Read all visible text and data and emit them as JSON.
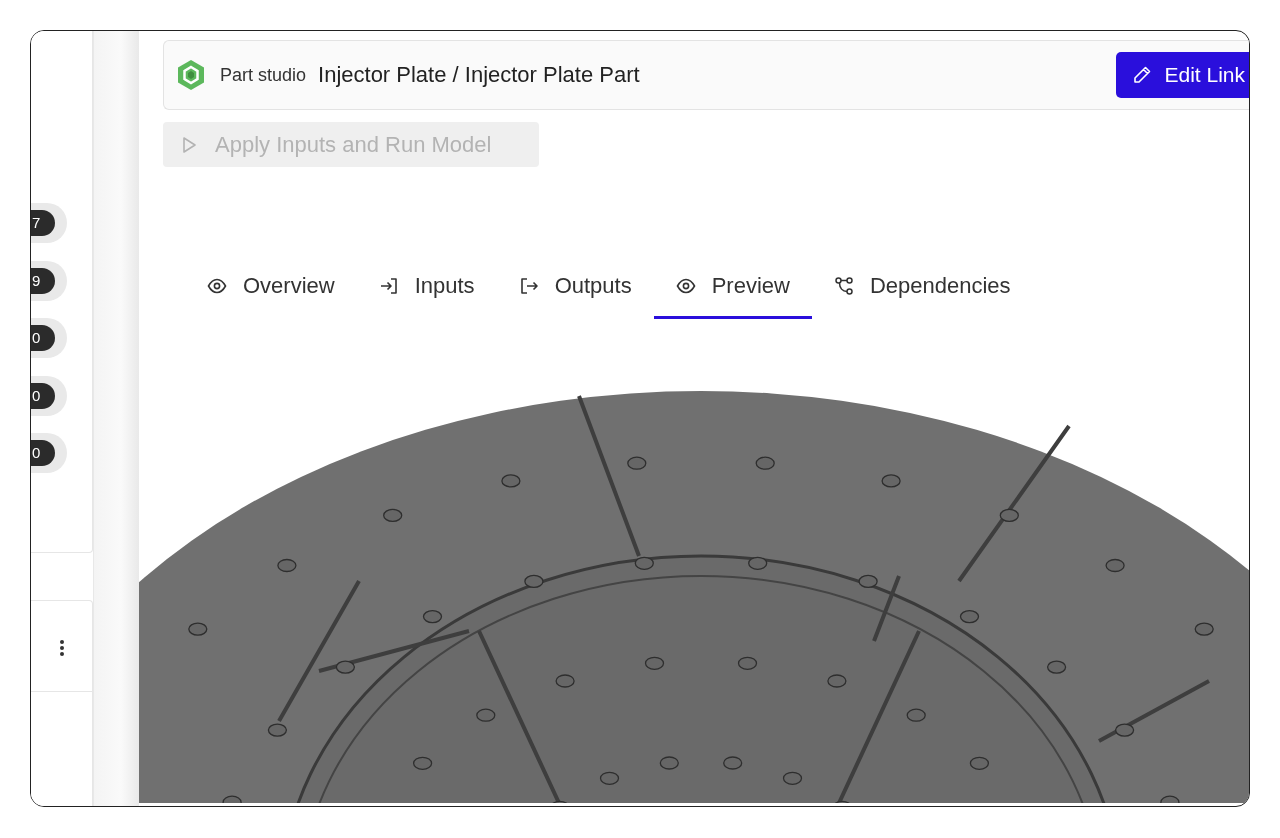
{
  "sidebar": {
    "badges": [
      {
        "count": "7"
      },
      {
        "count": "9"
      },
      {
        "count": "0"
      },
      {
        "count": "0"
      },
      {
        "count": "0"
      }
    ]
  },
  "header": {
    "type_label": "Part studio",
    "title": "Injector Plate / Injector Plate Part",
    "edit_button": "Edit Link"
  },
  "run_button": {
    "label": "Apply Inputs and Run Model",
    "disabled": true
  },
  "tabs": [
    {
      "label": "Overview",
      "selected": false
    },
    {
      "label": "Inputs",
      "selected": false
    },
    {
      "label": "Outputs",
      "selected": false
    },
    {
      "label": "Preview",
      "selected": true
    },
    {
      "label": "Dependencies",
      "selected": false
    }
  ]
}
